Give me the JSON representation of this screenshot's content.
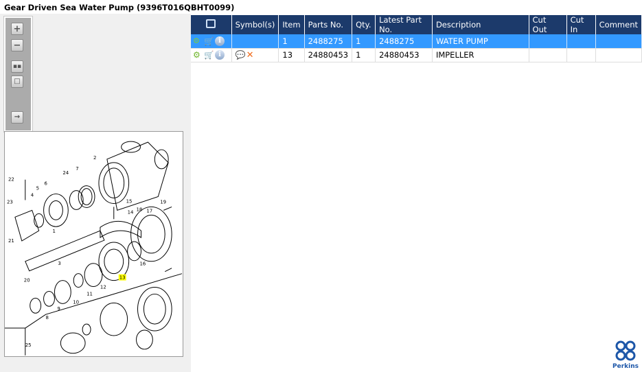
{
  "title": "Gear Driven Sea Water Pump (9396T016QBHT0099)",
  "toolbar": {
    "buttons": [
      "zoom-in",
      "zoom-out",
      "fit-all",
      "fit-window",
      "export"
    ]
  },
  "columns": [
    "",
    "Symbol(s)",
    "Item",
    "Parts No.",
    "Qty.",
    "Latest Part No.",
    "Description",
    "Cut Out",
    "Cut In",
    "Comment"
  ],
  "rows": [
    {
      "item": "1",
      "parts_no": "2488275",
      "qty": "1",
      "latest": "2488275",
      "description": "WATER PUMP",
      "cut_out": "",
      "cut_in": "",
      "comment": "",
      "selected": true
    },
    {
      "item": "13",
      "parts_no": "24880453",
      "qty": "1",
      "latest": "24880453",
      "description": "IMPELLER",
      "cut_out": "",
      "cut_in": "",
      "comment": "",
      "selected": false
    }
  ],
  "callouts": [
    "2",
    "24",
    "7",
    "22",
    "6",
    "5",
    "23",
    "4",
    "15",
    "19",
    "14",
    "18",
    "17",
    "21",
    "1",
    "3",
    "16",
    "20",
    "13",
    "12",
    "11",
    "10",
    "9",
    "8",
    "25"
  ],
  "highlight_callout": "13",
  "logo": "Perkins",
  "colors": {
    "header": "#1c3a6b",
    "selected": "#3399ff",
    "highlight": "#ffff00"
  }
}
